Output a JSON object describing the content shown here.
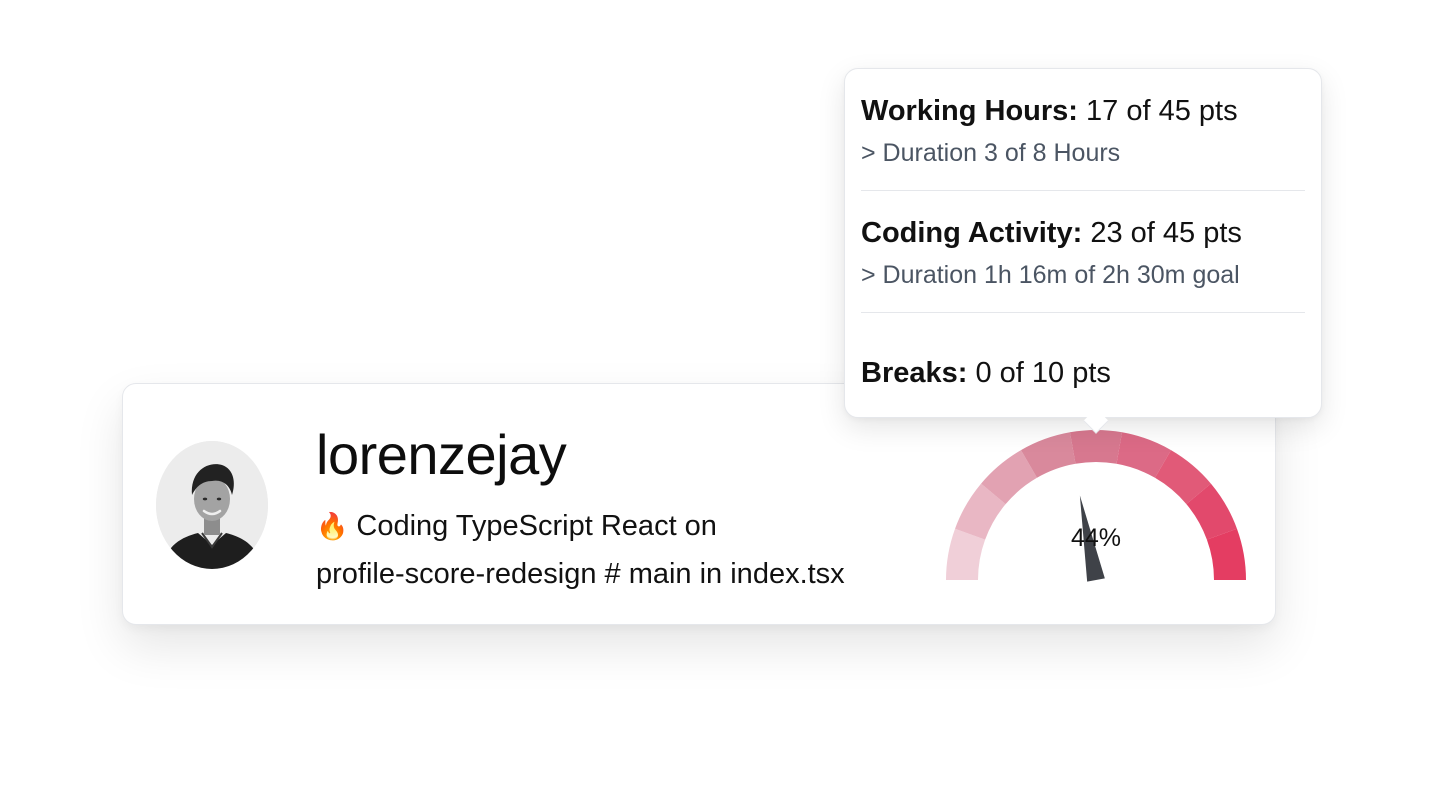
{
  "profile": {
    "username": "lorenzejay",
    "activity_emoji": "🔥",
    "activity_line1": "Coding TypeScript React on",
    "activity_line2": "profile-score-redesign # main in index.tsx"
  },
  "gauge": {
    "percent_label": "44%",
    "value_percent": 44,
    "colors": [
      "#f0cfd8",
      "#e9b7c4",
      "#e2a2b2",
      "#d9899c",
      "#d7788f",
      "#dc6a86",
      "#e15a78",
      "#e2496c",
      "#e43d62"
    ]
  },
  "tooltip": {
    "working_hours": {
      "label": "Working Hours:",
      "value": "17 of 45 pts",
      "detail": "> Duration 3 of 8 Hours"
    },
    "coding_activity": {
      "label": "Coding Activity:",
      "value": "23 of 45 pts",
      "detail": "> Duration 1h 16m of 2h 30m goal"
    },
    "breaks": {
      "label": "Breaks:",
      "value": "0 of 10 pts"
    }
  }
}
